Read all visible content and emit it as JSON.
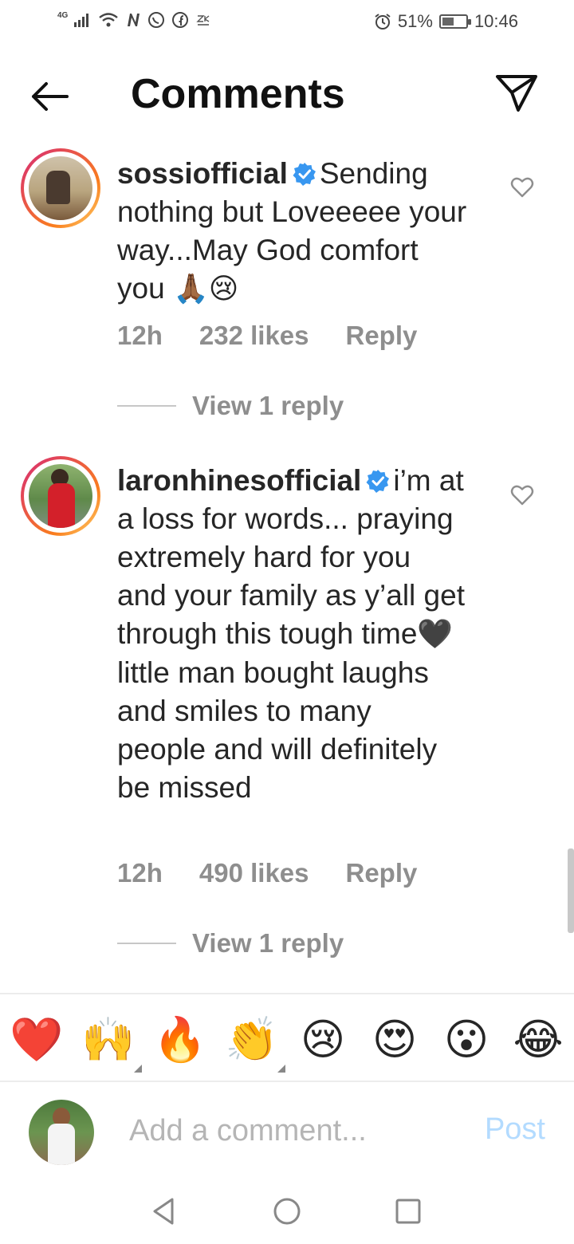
{
  "status_bar": {
    "network": "4G",
    "battery": "51%",
    "battery_level": 0.51,
    "time": "10:46",
    "left_icons": [
      "signal-icon",
      "wifi-icon",
      "n-icon",
      "whatsapp-icon",
      "facebook-icon",
      "zk-icon"
    ],
    "right_icons": [
      "alarm-icon",
      "battery-icon"
    ]
  },
  "header": {
    "title": "Comments"
  },
  "comments": [
    {
      "username": "sossiofficial",
      "text": "Sending nothing but Loveeeee your way...May God comfort you",
      "emojis": "🙏🏾😢",
      "time": "12h",
      "likes": "232 likes",
      "reply_label": "Reply",
      "view_replies": "View 1 reply"
    },
    {
      "username": "laronhinesofficial",
      "text_a": "i’m at a loss for words... praying extremely hard for you and your family as y’all get through this tough time",
      "text_emoji": "🖤",
      "text_b": " little man bought laughs and smiles to many people and will definitely be missed",
      "time": "12h",
      "likes": "490 likes",
      "reply_label": "Reply",
      "view_replies": "View 1 reply"
    }
  ],
  "emoji_bar": [
    "❤️",
    "🙌",
    "🔥",
    "👏",
    "😢",
    "😍",
    "😮",
    "😂"
  ],
  "add_comment": {
    "placeholder": "Add a comment...",
    "post_label": "Post"
  },
  "colors": {
    "verified": "#3897f0",
    "post": "#b3dbff",
    "meta": "#8e8e8e"
  }
}
